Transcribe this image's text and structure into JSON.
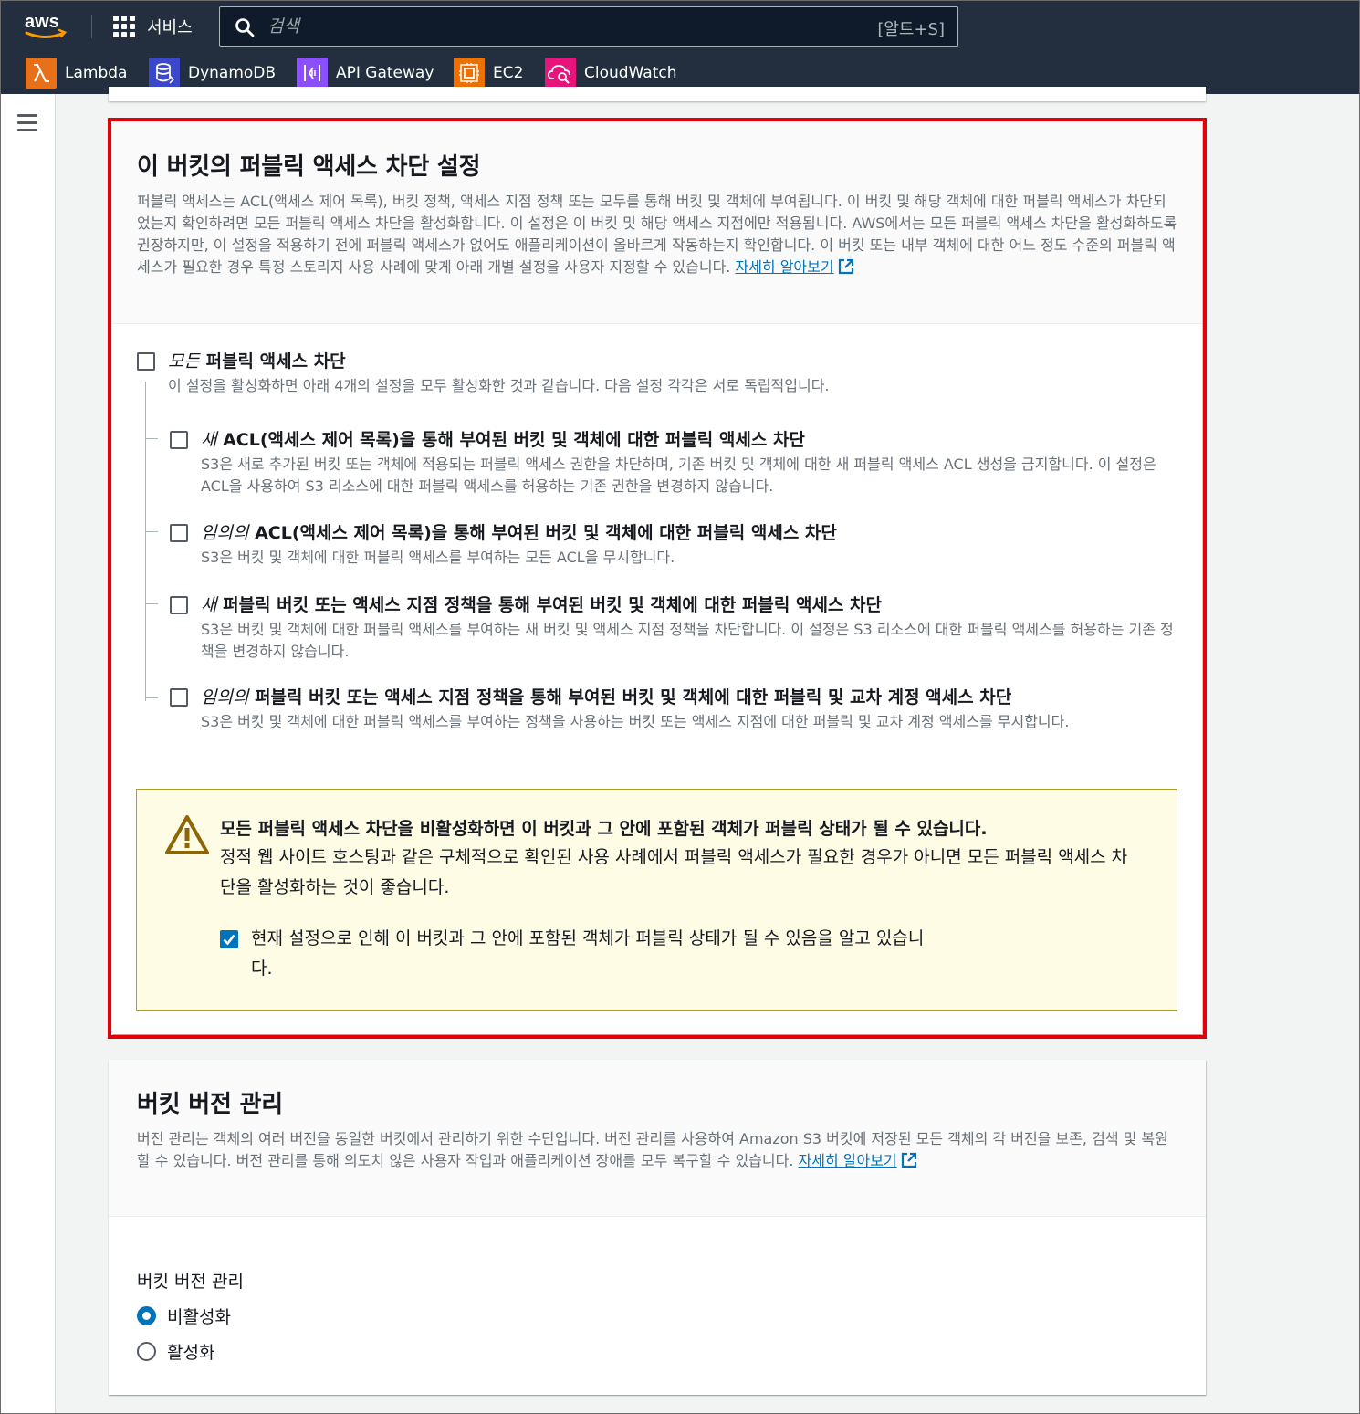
{
  "topnav": {
    "logo_text": "aws",
    "services_label": "서비스",
    "search_placeholder": "검색",
    "search_shortcut": "[알트+S]"
  },
  "favorites": [
    {
      "label": "Lambda",
      "icon": "lambda-icon",
      "color": "#e7701b"
    },
    {
      "label": "DynamoDB",
      "icon": "dynamodb-icon",
      "color": "#3b48cc"
    },
    {
      "label": "API Gateway",
      "icon": "api-gateway-icon",
      "color": "#8c4fff"
    },
    {
      "label": "EC2",
      "icon": "ec2-icon",
      "color": "#ed7100"
    },
    {
      "label": "CloudWatch",
      "icon": "cloudwatch-icon",
      "color": "#e7157b"
    }
  ],
  "block_public_access": {
    "title": "이 버킷의 퍼블릭 액세스 차단 설정",
    "description": "퍼블릭 액세스는 ACL(액세스 제어 목록), 버킷 정책, 액세스 지점 정책 또는 모두를 통해 버킷 및 객체에 부여됩니다. 이 버킷 및 해당 객체에 대한 퍼블릭 액세스가 차단되었는지 확인하려면 모든 퍼블릭 액세스 차단을 활성화합니다. 이 설정은 이 버킷 및 해당 액세스 지점에만 적용됩니다. AWS에서는 모든 퍼블릭 액세스 차단을 활성화하도록 권장하지만, 이 설정을 적용하기 전에 퍼블릭 액세스가 없어도 애플리케이션이 올바르게 작동하는지 확인합니다. 이 버킷 또는 내부 객체에 대한 어느 정도 수준의 퍼블릭 액세스가 필요한 경우 특정 스토리지 사용 사례에 맞게 아래 개별 설정을 사용자 지정할 수 있습니다.",
    "learn_more": "자세히 알아보기",
    "all": {
      "title_em": "모든",
      "title_rest": " 퍼블릭 액세스 차단",
      "desc": "이 설정을 활성화하면 아래 4개의 설정을 모두 활성화한 것과 같습니다. 다음 설정 각각은 서로 독립적입니다.",
      "checked": false
    },
    "options": [
      {
        "title_em": "새",
        "title_rest": " ACL(액세스 제어 목록)을 통해 부여된 버킷 및 객체에 대한 퍼블릭 액세스 차단",
        "desc": "S3은 새로 추가된 버킷 또는 객체에 적용되는 퍼블릭 액세스 권한을 차단하며, 기존 버킷 및 객체에 대한 새 퍼블릭 액세스 ACL 생성을 금지합니다. 이 설정은 ACL을 사용하여 S3 리소스에 대한 퍼블릭 액세스를 허용하는 기존 권한을 변경하지 않습니다.",
        "checked": false
      },
      {
        "title_em": "임의의",
        "title_rest": " ACL(액세스 제어 목록)을 통해 부여된 버킷 및 객체에 대한 퍼블릭 액세스 차단",
        "desc": "S3은 버킷 및 객체에 대한 퍼블릭 액세스를 부여하는 모든 ACL을 무시합니다.",
        "checked": false
      },
      {
        "title_em": "새",
        "title_rest": " 퍼블릭 버킷 또는 액세스 지점 정책을 통해 부여된 버킷 및 객체에 대한 퍼블릭 액세스 차단",
        "desc": "S3은 버킷 및 객체에 대한 퍼블릭 액세스를 부여하는 새 버킷 및 액세스 지점 정책을 차단합니다. 이 설정은 S3 리소스에 대한 퍼블릭 액세스를 허용하는 기존 정책을 변경하지 않습니다.",
        "checked": false
      },
      {
        "title_em": "임의의",
        "title_rest": " 퍼블릭 버킷 또는 액세스 지점 정책을 통해 부여된 버킷 및 객체에 대한 퍼블릭 및 교차 계정 액세스 차단",
        "desc": "S3은 버킷 및 객체에 대한 퍼블릭 액세스를 부여하는 정책을 사용하는 버킷 또는 액세스 지점에 대한 퍼블릭 및 교차 계정 액세스를 무시합니다.",
        "checked": false
      }
    ],
    "warning": {
      "title": "모든 퍼블릭 액세스 차단을 비활성화하면 이 버킷과 그 안에 포함된 객체가 퍼블릭 상태가 될 수 있습니다.",
      "text": "정적 웹 사이트 호스팅과 같은 구체적으로 확인된 사용 사례에서 퍼블릭 액세스가 필요한 경우가 아니면 모든 퍼블릭 액세스 차단을 활성화하는 것이 좋습니다.",
      "ack_text": "현재 설정으로 인해 이 버킷과 그 안에 포함된 객체가 퍼블릭 상태가 될 수 있음을 알고 있습니다.",
      "ack_checked": true
    }
  },
  "versioning": {
    "title": "버킷 버전 관리",
    "description": "버전 관리는 객체의 여러 버전을 동일한 버킷에서 관리하기 위한 수단입니다. 버전 관리를 사용하여 Amazon S3 버킷에 저장된 모든 객체의 각 버전을 보존, 검색 및 복원할 수 있습니다. 버전 관리를 통해 의도치 않은 사용자 작업과 애플리케이션 장애를 모두 복구할 수 있습니다.",
    "learn_more": "자세히 알아보기",
    "field_label": "버킷 버전 관리",
    "options": [
      {
        "label": "비활성화",
        "selected": true
      },
      {
        "label": "활성화",
        "selected": false
      }
    ]
  }
}
